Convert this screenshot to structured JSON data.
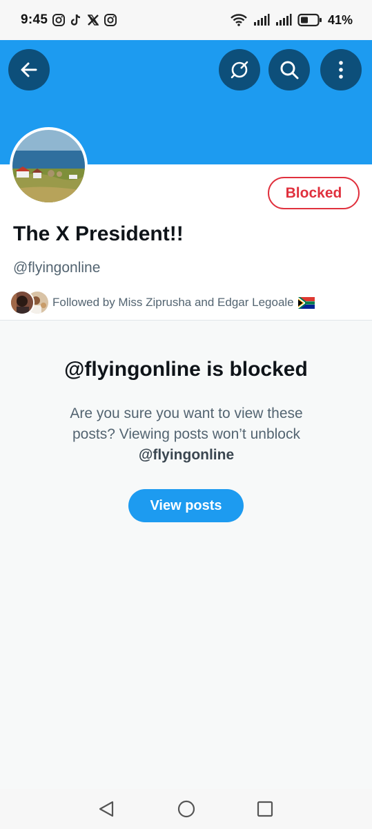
{
  "status_bar": {
    "time": "9:45",
    "app_icons": [
      "instagram-icon",
      "tiktok-icon",
      "x-icon",
      "instagram-icon"
    ],
    "battery_percent": "41%"
  },
  "header": {
    "banner_color": "#1d9bf0",
    "button_color": "#0d4f7a",
    "icons": [
      "back-arrow-icon",
      "grok-icon",
      "search-icon",
      "more-vertical-icon"
    ]
  },
  "profile": {
    "display_name": "The X President!!",
    "handle": "@flyingonline",
    "blocked_label": "Blocked",
    "followed_by": "Followed by Miss Ziprusha and Edgar Legoale",
    "followed_flag": "south-africa-flag-icon"
  },
  "blocked_notice": {
    "title": "@flyingonline is blocked",
    "description": "Are you sure you want to view these posts? Viewing posts won’t unblock",
    "handle": "@flyingonline",
    "button_label": "View posts"
  },
  "colors": {
    "accent": "#1d9bf0",
    "blocked_red": "#e0303d",
    "secondary_text": "#536471"
  }
}
